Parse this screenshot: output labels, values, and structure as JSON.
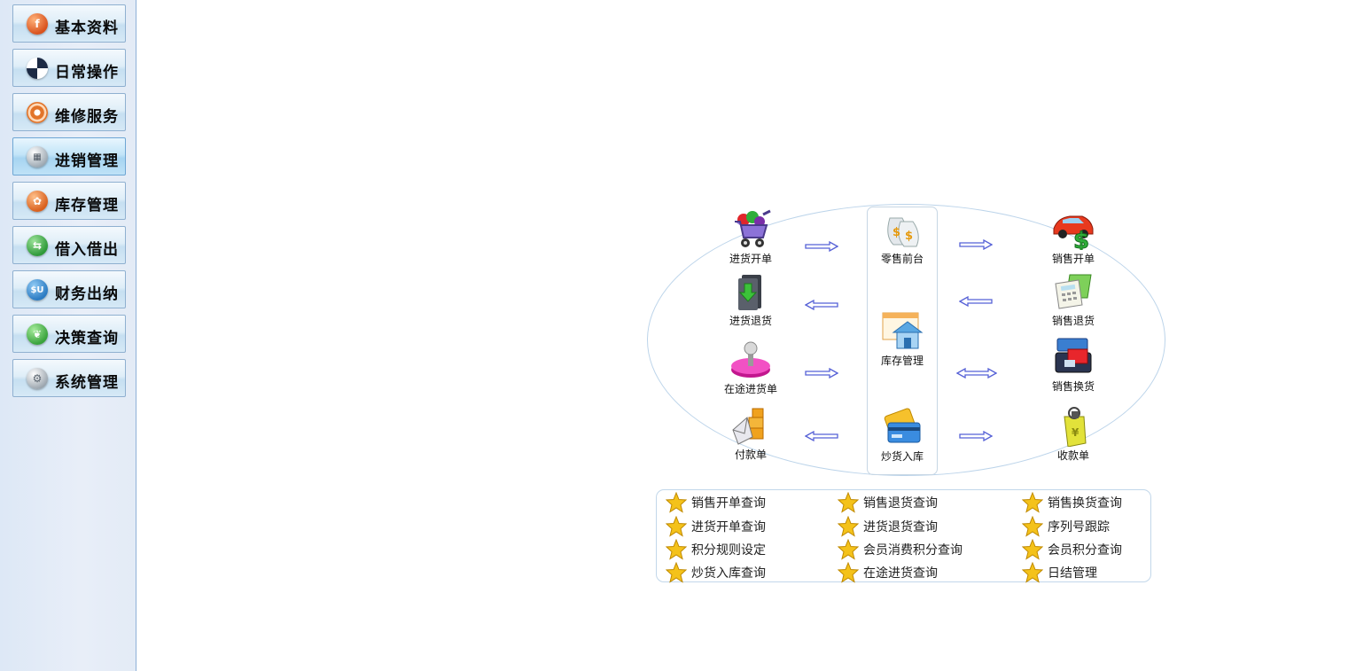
{
  "sidebar": {
    "items": [
      {
        "label": "基本资料",
        "icon": "info-icon",
        "color": "#d9531e",
        "active": false
      },
      {
        "label": "日常操作",
        "icon": "compass-icon",
        "color": "#3b4c6b",
        "active": false
      },
      {
        "label": "维修服务",
        "icon": "target-icon",
        "color": "#e2742a",
        "active": false
      },
      {
        "label": "进销管理",
        "icon": "chart-icon",
        "color": "#9aa6b0",
        "active": true
      },
      {
        "label": "库存管理",
        "icon": "flower-icon",
        "color": "#d9611e",
        "active": false
      },
      {
        "label": "借入借出",
        "icon": "swap-icon",
        "color": "#2f9a3a",
        "active": false
      },
      {
        "label": "财务出纳",
        "icon": "money-icon",
        "color": "#2c7cc3",
        "active": false
      },
      {
        "label": "决策查询",
        "icon": "leaf-icon",
        "color": "#3aa33d",
        "active": false
      },
      {
        "label": "系统管理",
        "icon": "gear-icon",
        "color": "#9aa4ad",
        "active": false
      }
    ]
  },
  "flow": {
    "left": [
      {
        "label": "进货开单",
        "icon": "shopping-cart-icon"
      },
      {
        "label": "进货退货",
        "icon": "folder-download-icon"
      },
      {
        "label": "在途进货单",
        "icon": "joystick-icon"
      },
      {
        "label": "付款单",
        "icon": "boxes-mail-icon"
      }
    ],
    "center": [
      {
        "label": "零售前台",
        "icon": "money-bags-icon"
      },
      {
        "label": "库存管理",
        "icon": "warehouse-icon"
      },
      {
        "label": "炒货入库",
        "icon": "credit-cards-icon"
      }
    ],
    "right": [
      {
        "label": "销售开单",
        "icon": "car-dollar-icon"
      },
      {
        "label": "销售退货",
        "icon": "calculator-icon"
      },
      {
        "label": "销售换货",
        "icon": "exchange-box-icon"
      },
      {
        "label": "收款单",
        "icon": "receipt-tag-icon"
      }
    ]
  },
  "queries": [
    [
      "销售开单查询",
      "销售退货查询",
      "销售换货查询"
    ],
    [
      "进货开单查询",
      "进货退货查询",
      "序列号跟踪"
    ],
    [
      "积分规则设定",
      "会员消费积分查询",
      "会员积分查询"
    ],
    [
      "炒货入库查询",
      "在途进货查询",
      "日结管理"
    ]
  ],
  "colors": {
    "arrow_stroke": "#5560d6",
    "arrow_fill": "#ffffff",
    "star": "#f4c21a"
  }
}
